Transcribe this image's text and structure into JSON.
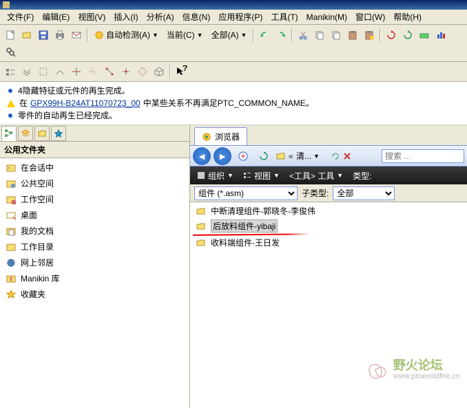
{
  "menubar": {
    "file": "文件(F)",
    "edit": "编辑(E)",
    "view": "视图(V)",
    "insert": "插入(I)",
    "analyze": "分析(A)",
    "info": "信息(N)",
    "app": "应用程序(P)",
    "tools": "工具(T)",
    "manikin": "Manikin(M)",
    "window": "窗口(W)",
    "help": "帮助(H)"
  },
  "toolbar": {
    "auto_check": "自动检测(A)",
    "current": "当前(C)",
    "all": "全部(A)"
  },
  "messages": {
    "m1": "4隐藏特征或元件的再生完成。",
    "m2_a": "在",
    "m2_link": "GPX99H-B24AT11070723_00",
    "m2_b": "中某些关系不再满足PTC_COMMON_NAME。",
    "m3": "零件的自动再生已经完成。"
  },
  "left": {
    "header": "公用文件夹",
    "items": [
      {
        "label": "在会话中",
        "icon": "session"
      },
      {
        "label": "公共空间",
        "icon": "public"
      },
      {
        "label": "工作空间",
        "icon": "workspace"
      },
      {
        "label": "桌面",
        "icon": "desktop"
      },
      {
        "label": "我的文档",
        "icon": "mydocs"
      },
      {
        "label": "工作目录",
        "icon": "workdir"
      },
      {
        "label": "网上邻居",
        "icon": "network"
      },
      {
        "label": "Manikin 库",
        "icon": "manikin"
      },
      {
        "label": "收藏夹",
        "icon": "favorites"
      }
    ]
  },
  "browser": {
    "tab_label": "浏览器",
    "nav": {
      "addr": "清...",
      "search_placeholder": "搜索 ..."
    },
    "org_bar": {
      "org": "组织",
      "view": "视图",
      "tools": "<工具> 工具",
      "type": "类型:"
    },
    "filter": {
      "sel1": "组件 (*.asm)",
      "subtype_label": "子类型:",
      "sel2": "全部"
    },
    "files": [
      {
        "label": "中断清理组件-郭晓冬-李俊伟"
      },
      {
        "label": "后放料组件-yibaji"
      },
      {
        "label": "收料端组件-王日发"
      }
    ]
  },
  "watermark": {
    "cn": "野火论坛",
    "url": "www.proewildfire.cn"
  }
}
